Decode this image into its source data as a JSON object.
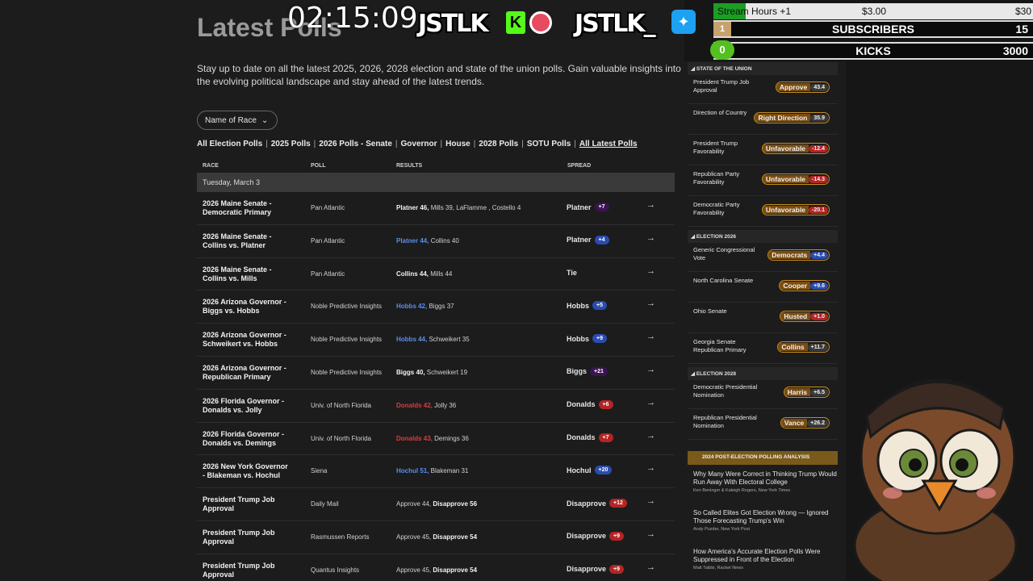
{
  "header": {
    "title": "Latest Polls",
    "intro": "Stay up to date on all the latest 2025, 2026, 2028 election and state of the union polls. Gain valuable insights into the evolving political landscape and stay ahead of the latest trends.",
    "race_button": "Name of Race"
  },
  "links": [
    "All Election Polls",
    "2025 Polls",
    "2026 Polls -",
    "Senate",
    "Governor",
    "House",
    "2028 Polls",
    "SOTU Polls",
    "All Latest Polls"
  ],
  "table": {
    "columns": [
      "RACE",
      "POLL",
      "RESULTS",
      "SPREAD"
    ],
    "date": "Tuesday, March 3",
    "rows": [
      {
        "race": "2026 Maine Senate - Democratic Primary",
        "poll": "Pan Atlantic",
        "r1": "Platner 46,",
        "r1c": "b",
        "r2": " Mills 39, LaFlamme , Costello 4",
        "spread": "Platner",
        "val": "+7",
        "pc": "#3b1450"
      },
      {
        "race": "2026 Maine Senate - Collins vs. Platner",
        "poll": "Pan Atlantic",
        "r1": "Platner 44,",
        "r1c": "blue",
        "r2": " Collins 40",
        "spread": "Platner",
        "val": "+4",
        "pc": "#2a4bb0"
      },
      {
        "race": "2026 Maine Senate - Collins vs. Mills",
        "poll": "Pan Atlantic",
        "r1": "Collins 44,",
        "r1c": "b",
        "r2": " Mills 44",
        "spread": "Tie",
        "val": "",
        "pc": ""
      },
      {
        "race": "2026 Arizona Governor - Biggs vs. Hobbs",
        "poll": "Noble Predictive Insights",
        "r1": "Hobbs 42,",
        "r1c": "blue",
        "r2": " Biggs 37",
        "spread": "Hobbs",
        "val": "+5",
        "pc": "#2a4bb0"
      },
      {
        "race": "2026 Arizona Governor - Schweikert vs. Hobbs",
        "poll": "Noble Predictive Insights",
        "r1": "Hobbs 44,",
        "r1c": "blue",
        "r2": " Schweikert 35",
        "spread": "Hobbs",
        "val": "+9",
        "pc": "#2a4bb0"
      },
      {
        "race": "2026 Arizona Governor - Republican Primary",
        "poll": "Noble Predictive Insights",
        "r1": "Biggs 40,",
        "r1c": "b",
        "r2": " Schweikert 19",
        "spread": "Biggs",
        "val": "+21",
        "pc": "#3b1450"
      },
      {
        "race": "2026 Florida Governor - Donalds vs. Jolly",
        "poll": "Univ. of North Florida",
        "r1": "Donalds 42,",
        "r1c": "red",
        "r2": " Jolly 36",
        "spread": "Donalds",
        "val": "+6",
        "pc": "#b52424"
      },
      {
        "race": "2026 Florida Governor - Donalds vs. Demings",
        "poll": "Univ. of North Florida",
        "r1": "Donalds 43,",
        "r1c": "red",
        "r2": " Demings 36",
        "spread": "Donalds",
        "val": "+7",
        "pc": "#b52424"
      },
      {
        "race": "2026 New York Governor - Blakeman vs. Hochul",
        "poll": "Siena",
        "r1": "Hochul 51,",
        "r1c": "blue",
        "r2": " Blakeman 31",
        "spread": "Hochul",
        "val": "+20",
        "pc": "#2a4bb0"
      },
      {
        "race": "President Trump Job Approval",
        "poll": "Daily Mail",
        "r0": "Approve 44, ",
        "r1": "Disapprove 56",
        "r1c": "b",
        "r2": "",
        "spread": "Disapprove",
        "val": "+12",
        "pc": "#b52424"
      },
      {
        "race": "President Trump Job Approval",
        "poll": "Rasmussen Reports",
        "r0": "Approve 45, ",
        "r1": "Disapprove 54",
        "r1c": "b",
        "r2": "",
        "spread": "Disapprove",
        "val": "+9",
        "pc": "#b52424"
      },
      {
        "race": "President Trump Job Approval",
        "poll": "Quantus Insights",
        "r0": "Approve 45, ",
        "r1": "Disapprove 54",
        "r1c": "b",
        "r2": "",
        "spread": "Disapprove",
        "val": "+9",
        "pc": "#b52424"
      }
    ]
  },
  "sidebar": {
    "sections": [
      {
        "title": "State of the Union",
        "items": [
          {
            "label": "President Trump Job Approval",
            "name": "Approve",
            "val": "43.4",
            "c": "amb"
          },
          {
            "label": "Direction of Country",
            "name": "Right Direction",
            "val": "35.9",
            "c": "amb"
          },
          {
            "label": "President Trump Favorability",
            "name": "Unfavorable",
            "val": "-12.4",
            "c": "red"
          },
          {
            "label": "Republican Party Favorability",
            "name": "Unfavorable",
            "val": "-14.3",
            "c": "red"
          },
          {
            "label": "Democratic Party Favorability",
            "name": "Unfavorable",
            "val": "-20.1",
            "c": "red"
          }
        ]
      },
      {
        "title": "Election 2026",
        "items": [
          {
            "label": "Generic Congressional Vote",
            "name": "Democrats",
            "val": "+4.4",
            "c": "blue"
          },
          {
            "label": "North Carolina Senate",
            "name": "Cooper",
            "val": "+9.6",
            "c": "blue"
          },
          {
            "label": "Ohio Senate",
            "name": "Husted",
            "val": "+1.0",
            "c": "red"
          },
          {
            "label": "Georgia Senate Republican Primary",
            "name": "Collins",
            "val": "+11.7",
            "c": "amb"
          }
        ]
      },
      {
        "title": "Election 2028",
        "items": [
          {
            "label": "Democratic Presidential Nomination",
            "name": "Harris",
            "val": "+6.5",
            "c": "amb"
          },
          {
            "label": "Republican Presidential Nomination",
            "name": "Vance",
            "val": "+26.2",
            "c": "amb"
          }
        ]
      }
    ],
    "analysis_title": "2024 Post-Election Polling Analysis",
    "articles": [
      {
        "title": "Why Many Were Correct in Thinking Trump Would Run Away With Electoral College",
        "author": "Ken Beninger & Kaleigh Rogers, New York Times"
      },
      {
        "title": "So Called Elites Got Election Wrong — Ignored Those Forecasting Trump's Win",
        "author": "Andy Puzder, New York Post"
      },
      {
        "title": "How America's Accurate Election Polls Were Suppressed in Front of the Election",
        "author": "Matt Taibbi, Racket News"
      }
    ]
  },
  "overlay": {
    "clock": "02:15:09",
    "brand1": "JSTLK",
    "brand2": "JSTLK_",
    "goal": {
      "label": "Stream Hours +1",
      "amount": "$3.00",
      "target": "$30",
      "progress": 0.1
    },
    "subs": {
      "num": "1",
      "label": "SUBSCRIBERS",
      "value": "15"
    },
    "kicks": {
      "num": "0",
      "label": "KICKS",
      "value": "3000"
    }
  }
}
